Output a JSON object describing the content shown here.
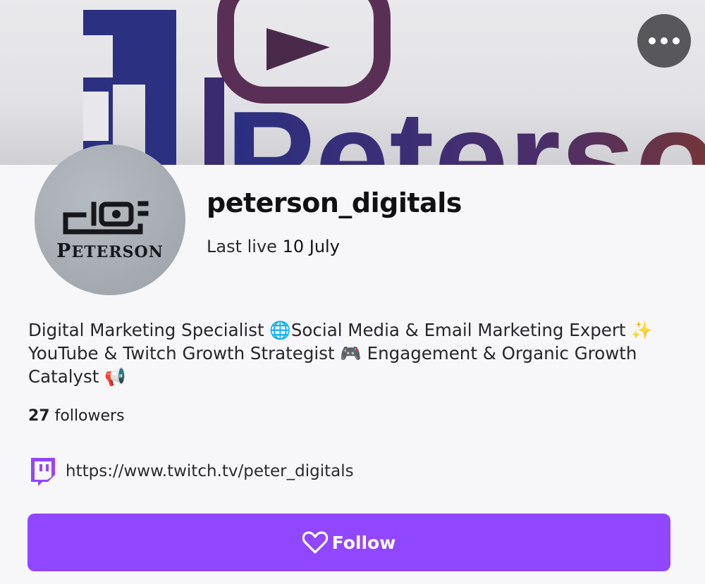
{
  "banner": {
    "logo_text": "Peterson",
    "more_label": "More options"
  },
  "avatar": {
    "cap": "P",
    "rest": "ETERSON"
  },
  "profile": {
    "username": "peterson_digitals",
    "last_live_prefix": "Last live",
    "last_live_date": "10 July",
    "bio": "Digital Marketing Specialist 🌐Social Media & Email Marketing Expert ✨ YouTube & Twitch Growth Strategist 🎮 Engagement & Organic Growth Catalyst 📢",
    "followers_count": "27",
    "followers_label": "followers",
    "link_url": "https://www.twitch.tv/peter_digitals"
  },
  "actions": {
    "follow_label": "Follow"
  },
  "colors": {
    "accent": "#9146ff",
    "more_button": "#58585c"
  },
  "icons": {
    "more": "more-horizontal-icon",
    "twitch": "twitch-icon",
    "follow": "heart-icon"
  }
}
